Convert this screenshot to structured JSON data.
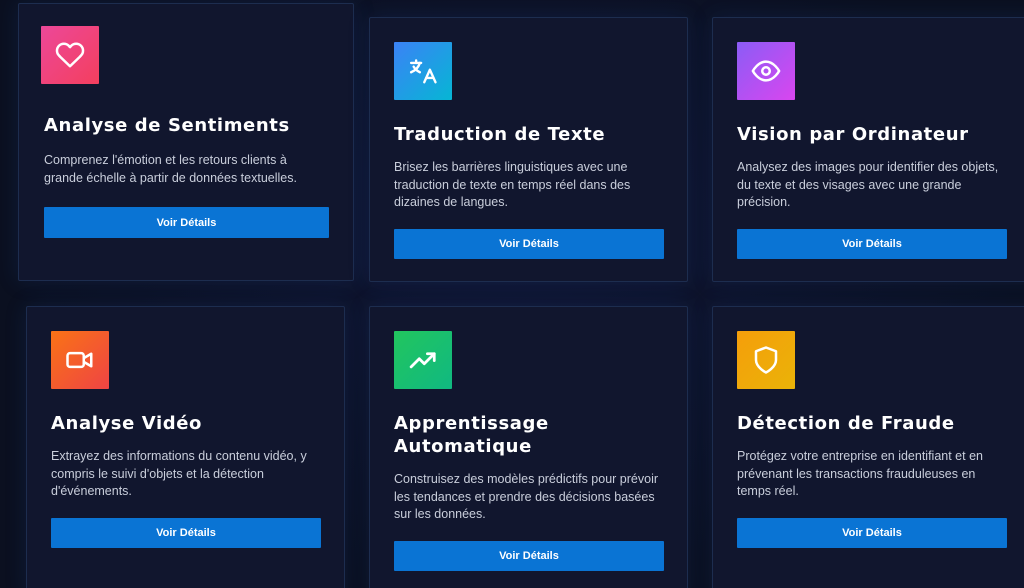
{
  "cards": [
    {
      "title": "Analyse de Sentiments",
      "description": "Comprenez l'émotion et les retours clients à grande échelle à partir de données textuelles.",
      "button_label": "Voir Détails",
      "icon": "heart-icon",
      "icon_colors": [
        "#ec4899",
        "#f43f5e"
      ]
    },
    {
      "title": "Traduction de Texte",
      "description": "Brisez les barrières linguistiques avec une traduction de texte en temps réel dans des dizaines de langues.",
      "button_label": "Voir Détails",
      "icon": "translate-icon",
      "icon_colors": [
        "#3b82f6",
        "#06b6d4"
      ]
    },
    {
      "title": "Vision par Ordinateur",
      "description": "Analysez des images pour identifier des objets, du texte et des visages avec une grande précision.",
      "button_label": "Voir Détails",
      "icon": "eye-icon",
      "icon_colors": [
        "#8b5cf6",
        "#d946ef"
      ]
    },
    {
      "title": "Analyse Vidéo",
      "description": "Extrayez des informations du contenu vidéo, y compris le suivi d'objets et la détection d'événements.",
      "button_label": "Voir Détails",
      "icon": "video-camera-icon",
      "icon_colors": [
        "#f97316",
        "#ef4444"
      ]
    },
    {
      "title": "Apprentissage Automatique",
      "description": "Construisez des modèles prédictifs pour prévoir les tendances et prendre des décisions basées sur les données.",
      "button_label": "Voir Détails",
      "icon": "trending-up-icon",
      "icon_colors": [
        "#22c55e",
        "#10b981"
      ]
    },
    {
      "title": "Détection de Fraude",
      "description": "Protégez votre entreprise en identifiant et en prévenant les transactions frauduleuses en temps réel.",
      "button_label": "Voir Détails",
      "icon": "shield-icon",
      "icon_colors": [
        "#f59e0b",
        "#eab308"
      ]
    }
  ],
  "colors": {
    "background": "#0b1020",
    "card_background": "#11162e",
    "card_border": "#1d2d4f",
    "button": "#0a74d4",
    "title_text": "#ffffff",
    "body_text": "#c9cedb"
  }
}
